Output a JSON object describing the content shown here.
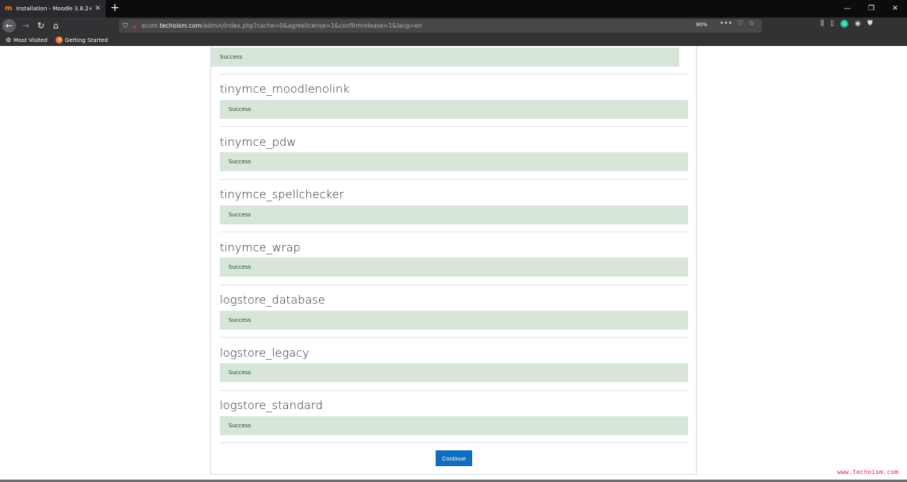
{
  "browser": {
    "tab_title": "Installation - Moodle 3.8.2+ (B",
    "tab_favicon": "m",
    "url_prefix": "ecom.",
    "url_host": "techoism.com",
    "url_path": "/admin/index.php?cache=0&agreelicense=1&confirmrelease=1&lang=en",
    "zoom": "90%",
    "bookmarks": [
      {
        "label": "Most Visited",
        "icon": "gear-icon"
      },
      {
        "label": "Getting Started",
        "icon": "firefox-icon"
      }
    ]
  },
  "plugins": [
    {
      "name": "",
      "status": "Success"
    },
    {
      "name": "tinymce_moodlenolink",
      "status": "Success"
    },
    {
      "name": "tinymce_pdw",
      "status": "Success"
    },
    {
      "name": "tinymce_spellchecker",
      "status": "Success"
    },
    {
      "name": "tinymce_wrap",
      "status": "Success"
    },
    {
      "name": "logstore_database",
      "status": "Success"
    },
    {
      "name": "logstore_legacy",
      "status": "Success"
    },
    {
      "name": "logstore_standard",
      "status": "Success"
    }
  ],
  "continue_label": "Continue",
  "watermark": "www.techoism.com",
  "colors": {
    "success_bg": "#d7e6d9",
    "button": "#0f6cbf"
  }
}
